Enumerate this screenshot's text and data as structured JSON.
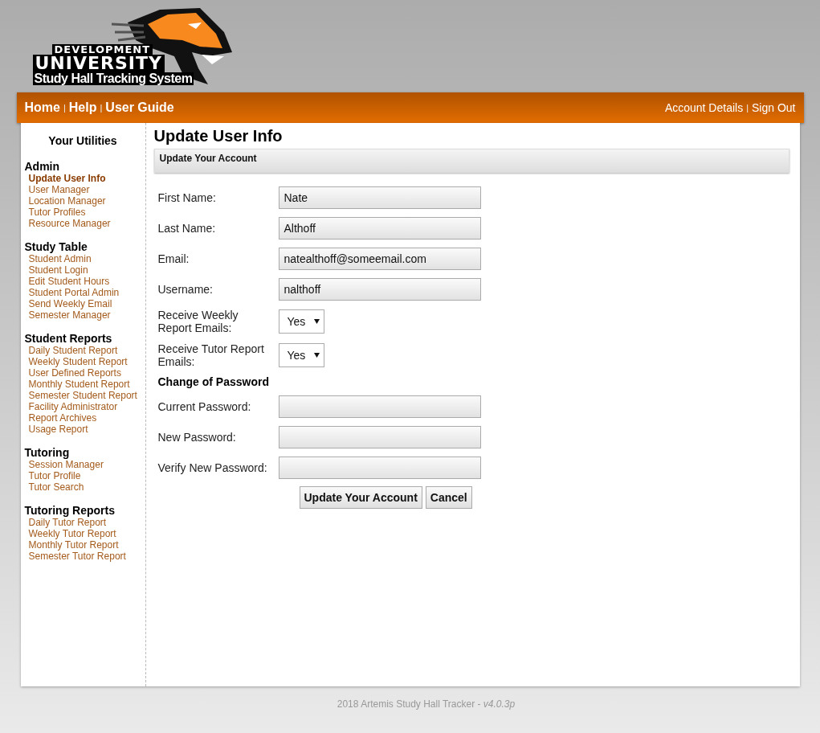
{
  "logo": {
    "line_1": "DEVELOPMENT",
    "line_2": "UNIVERSITY",
    "line_3": "Study Hall Tracking System"
  },
  "nav_left": [
    {
      "label": "Home"
    },
    {
      "label": "Help",
      "separator": "|"
    },
    {
      "label": "User Guide",
      "separator": "|"
    }
  ],
  "nav_right": [
    {
      "label": "Account Details"
    },
    {
      "label": "Sign Out",
      "separator": "|"
    }
  ],
  "sidebar": {
    "title": "Your Utilities",
    "sections": [
      {
        "heading": "Admin",
        "items": [
          {
            "label": "Update User Info",
            "selected": true
          },
          {
            "label": "User Manager",
            "selected": false
          },
          {
            "label": "Location Manager",
            "selected": false
          },
          {
            "label": "Tutor Profiles",
            "selected": false
          },
          {
            "label": "Resource Manager",
            "selected": false
          }
        ]
      },
      {
        "heading": "Study Table",
        "items": [
          {
            "label": "Student Admin",
            "selected": false
          },
          {
            "label": "Student Login",
            "selected": false
          },
          {
            "label": "Edit Student Hours",
            "selected": false
          },
          {
            "label": "Student Portal Admin",
            "selected": false
          },
          {
            "label": "Send Weekly Email",
            "selected": false
          },
          {
            "label": "Semester Manager",
            "selected": false
          }
        ]
      },
      {
        "heading": "Student Reports",
        "items": [
          {
            "label": "Daily Student Report",
            "selected": false
          },
          {
            "label": "Weekly Student Report",
            "selected": false
          },
          {
            "label": "User Defined Reports",
            "selected": false
          },
          {
            "label": "Monthly Student Report",
            "selected": false
          },
          {
            "label": "Semester Student Report",
            "selected": false
          },
          {
            "label": "Facility Administrator",
            "selected": false
          },
          {
            "label": "Report Archives",
            "selected": false
          },
          {
            "label": "Usage Report",
            "selected": false
          }
        ]
      },
      {
        "heading": "Tutoring",
        "items": [
          {
            "label": "Session Manager",
            "selected": false
          },
          {
            "label": "Tutor Profile",
            "selected": false
          },
          {
            "label": "Tutor Search",
            "selected": false
          }
        ]
      },
      {
        "heading": "Tutoring Reports",
        "items": [
          {
            "label": "Daily Tutor Report",
            "selected": false
          },
          {
            "label": "Weekly Tutor Report",
            "selected": false
          },
          {
            "label": "Monthly Tutor Report",
            "selected": false
          },
          {
            "label": "Semester Tutor Report",
            "selected": false
          }
        ]
      }
    ]
  },
  "page_title": "Update User Info",
  "panel_title": "Update Your Account",
  "form": [
    {
      "kind": "text",
      "label": "First Name:",
      "value": "Nate"
    },
    {
      "kind": "text",
      "label": "Last Name:",
      "value": "Althoff"
    },
    {
      "kind": "text",
      "label": "Email:",
      "value": "natealthoff@someemail.com"
    },
    {
      "kind": "text",
      "label": "Username:",
      "value": "nalthoff"
    },
    {
      "kind": "select",
      "label": "Receive Weekly Report Emails:",
      "value": "Yes"
    },
    {
      "kind": "select",
      "label": "Receive Tutor Report Emails:",
      "value": "Yes"
    },
    {
      "kind": "heading",
      "label": "Change of Password"
    },
    {
      "kind": "password",
      "label": "Current Password:"
    },
    {
      "kind": "password",
      "label": "New Password:"
    },
    {
      "kind": "password",
      "label": "Verify New Password:"
    }
  ],
  "buttons": [
    "Update Your Account",
    "Cancel"
  ],
  "footer": "2018 Artemis Study Hall Tracker - *v4.0.3p*"
}
